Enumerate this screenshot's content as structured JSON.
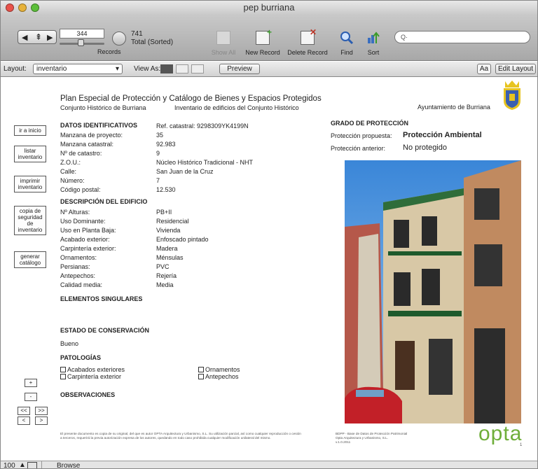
{
  "window": {
    "title": "pep burriana"
  },
  "toolbar": {
    "record_number": "344",
    "records_label": "Records",
    "total_count": "741",
    "total_label": "Total (Sorted)",
    "show_all": "Show All",
    "new_record": "New Record",
    "delete_record": "Delete Record",
    "find": "Find",
    "sort": "Sort",
    "search_placeholder": "Q·"
  },
  "layoutbar": {
    "layout_label": "Layout:",
    "layout_value": "inventario",
    "view_as_label": "View As:",
    "preview": "Preview",
    "aa": "Aa",
    "edit_layout": "Edit Layout"
  },
  "header": {
    "title": "Plan Especial de Protección y Catálogo de Bienes y Espacios Protegidos",
    "subtitle_left": "Conjunto Histórico de Burriana",
    "subtitle_right": "Inventario de edificios del Conjunto Histórico",
    "ayuntamiento": "Ayuntamiento de Burriana"
  },
  "side_buttons": {
    "ir_inicio": "ir a inicio",
    "listar": "listar inventario",
    "imprimir": "imprimir inventario",
    "copia": "copia de seguridad de inventario",
    "generar": "generar catálogo",
    "plus": "+",
    "minus": "-",
    "first": "<<",
    "last": ">>",
    "prev": "<",
    "next": ">"
  },
  "datos": {
    "heading": "DATOS IDENTIFICATIVOS",
    "ref_label": "Ref. catastral:",
    "ref_value": "9298309YK4199N",
    "rows": [
      {
        "label": "Manzana de proyecto:",
        "value": "35"
      },
      {
        "label": "Manzana catastral:",
        "value": "92.983"
      },
      {
        "label": "Nº de catastro:",
        "value": "9"
      },
      {
        "label": "Z.O.U.:",
        "value": "Núcleo Histórico Tradicional - NHT"
      },
      {
        "label": "Calle:",
        "value": "San Juan de la Cruz"
      },
      {
        "label": "Número:",
        "value": "7"
      },
      {
        "label": "Código postal:",
        "value": "12.530"
      }
    ]
  },
  "descripcion": {
    "heading": "DESCRIPCIÓN DEL EDIFICIO",
    "rows": [
      {
        "label": "Nº Alturas:",
        "value": "PB+II"
      },
      {
        "label": "Uso Dominante:",
        "value": "Residencial"
      },
      {
        "label": "Uso en Planta Baja:",
        "value": "Vivienda"
      },
      {
        "label": "Acabado exterior:",
        "value": "Enfoscado pintado"
      },
      {
        "label": "Carpintería exterior:",
        "value": "Madera"
      },
      {
        "label": "Ornamentos:",
        "value": "Ménsulas"
      },
      {
        "label": "Persianas:",
        "value": "PVC"
      },
      {
        "label": "Antepechos:",
        "value": "Rejería"
      },
      {
        "label": "Calidad media:",
        "value": "Media"
      }
    ]
  },
  "elementos": {
    "heading": "ELEMENTOS SINGULARES"
  },
  "estado": {
    "heading": "ESTADO DE CONSERVACIÓN",
    "value": "Bueno"
  },
  "patologias": {
    "heading": "PATOLOGÍAS",
    "items": [
      "Acabados exteriores",
      "Carpintería exterior",
      "Ornamentos",
      "Antepechos"
    ]
  },
  "observaciones": {
    "heading": "OBSERVACIONES"
  },
  "grado": {
    "heading": "GRADO DE PROTECCIÓN",
    "propuesta_label": "Protección propuesta:",
    "propuesta_value": "Protección Ambiental",
    "anterior_label": "Protección anterior:",
    "anterior_value": "No protegido"
  },
  "footer": {
    "legal": "El presente documento es copia de su original, del que es autor OPTA Arquitectura y Urbanismo, S.L. Su utilización parcial, así como cualquier reproducción o cesión a terceros, requerirá la previa autorización expresa de los autores, quedando en todo caso prohibida cualquier modificación unilateral del mismo.",
    "credits_1": "BDPP - Base de Datos de Protección Patrimonial",
    "credits_2": "Opta Arquitectura y Urbanismo, S.L.",
    "credits_3": "v.1.0.2011",
    "logo": "opta",
    "page": "1"
  },
  "statusbar": {
    "zoom": "100",
    "mode": "Browse"
  },
  "colors": {
    "accent_blue": "#3a5fb0",
    "logo_green": "#6fae3a",
    "shield_yellow": "#e7c420"
  }
}
